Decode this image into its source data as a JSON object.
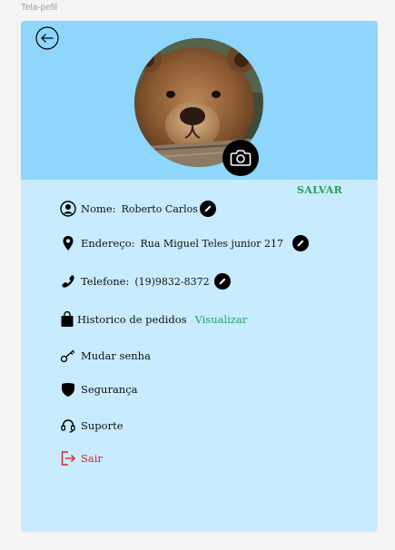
{
  "frame": {
    "title": "Tela-pefil"
  },
  "header": {
    "back_icon": "arrow-left-circle-icon",
    "avatar_alt": "bear",
    "camera_icon": "camera-icon"
  },
  "actions": {
    "save_label": "SALVAR"
  },
  "profile": {
    "name_label": "Nome:",
    "name_value": "Roberto Carlos",
    "address_label": "Endereço:",
    "address_value": "Rua Miguel Teles junior 217",
    "phone_label": "Telefone:",
    "phone_value": "(19)9832-8372"
  },
  "menu": {
    "orders_label": "Historico de pedidos",
    "orders_link": "Visualizar",
    "password_label": "Mudar senha",
    "security_label": "Segurança",
    "support_label": "Suporte",
    "logout_label": "Sair"
  },
  "colors": {
    "header_bg": "#8ed6fb",
    "card_bg": "#c8ebff",
    "accent_green": "#2a9d55",
    "danger_red": "#e0202a"
  }
}
